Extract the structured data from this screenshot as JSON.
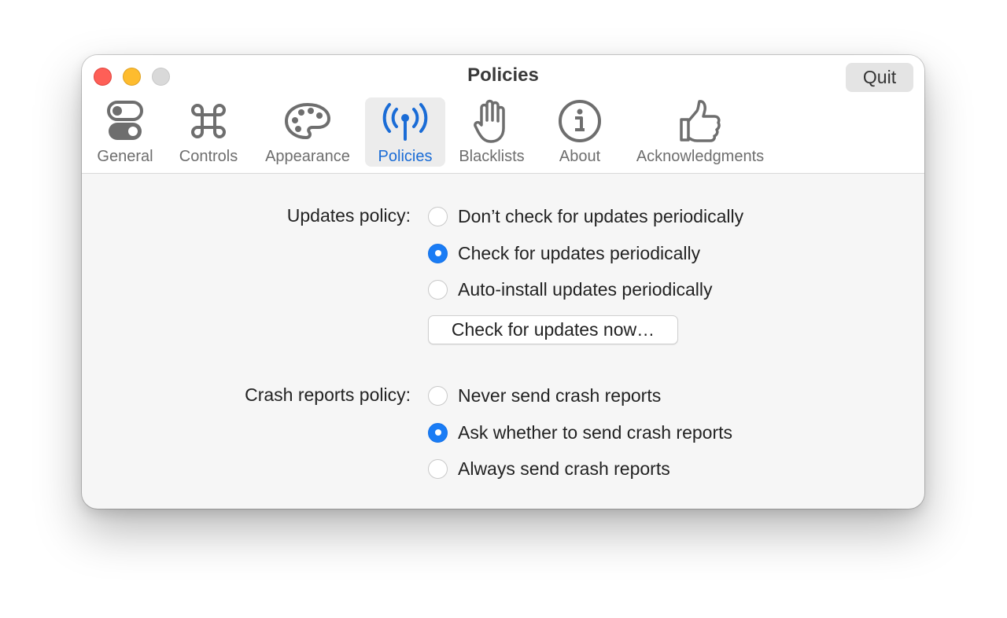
{
  "window": {
    "title": "Policies",
    "quit_label": "Quit"
  },
  "tabs": [
    {
      "label": "General",
      "icon": "toggle-switches-icon",
      "selected": false
    },
    {
      "label": "Controls",
      "icon": "command-key-icon",
      "selected": false
    },
    {
      "label": "Appearance",
      "icon": "palette-icon",
      "selected": false
    },
    {
      "label": "Policies",
      "icon": "antenna-broadcast-icon",
      "selected": true
    },
    {
      "label": "Blacklists",
      "icon": "raised-hand-icon",
      "selected": false
    },
    {
      "label": "About",
      "icon": "info-circle-icon",
      "selected": false
    },
    {
      "label": "Acknowledgments",
      "icon": "thumbs-up-icon",
      "selected": false
    }
  ],
  "updates": {
    "label": "Updates policy:",
    "options": [
      {
        "label": "Don’t check for updates periodically",
        "checked": false
      },
      {
        "label": "Check for updates periodically",
        "checked": true
      },
      {
        "label": "Auto-install updates periodically",
        "checked": false
      }
    ],
    "check_now_label": "Check for updates now…"
  },
  "crash_reports": {
    "label": "Crash reports policy:",
    "options": [
      {
        "label": "Never send crash reports",
        "checked": false
      },
      {
        "label": "Ask whether to send crash reports",
        "checked": true
      },
      {
        "label": "Always send crash reports",
        "checked": false
      }
    ]
  },
  "colors": {
    "accent": "#1a7cf5",
    "selected_tab_text": "#1a6cd6",
    "close": "#fe5f57",
    "minimize": "#febc2e",
    "zoom_disabled": "#d9d9d9"
  }
}
